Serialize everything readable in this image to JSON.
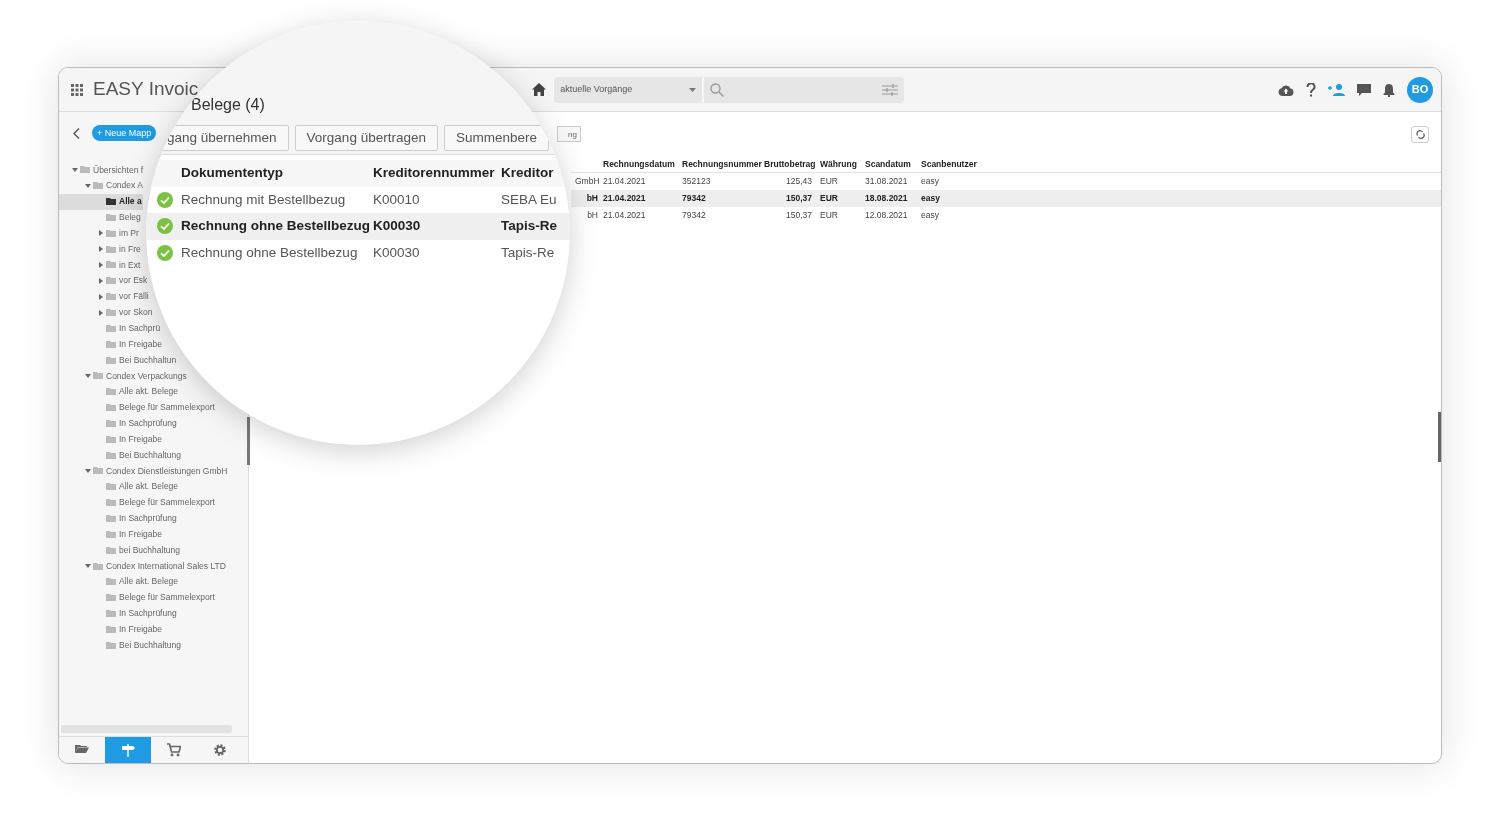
{
  "header": {
    "title": "EASY Invoic",
    "view_select": "aktuelle Vorgänge",
    "avatar": "BO"
  },
  "sidebar": {
    "new_button": "+ Neue Mapp",
    "tree": [
      {
        "label": "Übersichten f",
        "expanded": true,
        "selected": false,
        "children": [
          {
            "label": "Condex A",
            "expanded": true,
            "selected": false,
            "children": [
              {
                "label": "Alle a",
                "selected": true
              },
              {
                "label": "Beleg",
                "selected": false
              },
              {
                "label": "im Pr",
                "expanded": false,
                "selected": false
              },
              {
                "label": "in Fre",
                "expanded": false,
                "selected": false
              },
              {
                "label": "in Ext",
                "expanded": false,
                "selected": false
              },
              {
                "label": "vor Esk",
                "expanded": false,
                "selected": false
              },
              {
                "label": "vor Fälli",
                "expanded": false,
                "selected": false
              },
              {
                "label": "vor Skon",
                "expanded": false,
                "selected": false
              },
              {
                "label": "In Sachprü",
                "selected": false
              },
              {
                "label": "In Freigabe",
                "selected": false
              },
              {
                "label": "Bei Buchhaltun",
                "selected": false
              }
            ]
          },
          {
            "label": "Condex Verpackungs",
            "expanded": true,
            "selected": false,
            "children": [
              {
                "label": "Alle akt. Belege",
                "selected": false
              },
              {
                "label": "Belege für Sammelexport",
                "selected": false
              },
              {
                "label": "In Sachprüfung",
                "selected": false
              },
              {
                "label": "In Freigabe",
                "selected": false
              },
              {
                "label": "Bei Buchhaltung",
                "selected": false
              }
            ]
          },
          {
            "label": "Condex Dienstleistungen GmbH",
            "expanded": true,
            "selected": false,
            "children": [
              {
                "label": "Alle akt. Belege",
                "selected": false
              },
              {
                "label": "Belege für Sammelexport",
                "selected": false
              },
              {
                "label": "In Sachprüfung",
                "selected": false
              },
              {
                "label": "In Freigabe",
                "selected": false
              },
              {
                "label": "bei Buchhaltung",
                "selected": false
              }
            ]
          },
          {
            "label": "Condex International Sales LTD",
            "expanded": true,
            "selected": false,
            "children": [
              {
                "label": "Alle akt. Belege",
                "selected": false
              },
              {
                "label": "Belege für Sammelexport",
                "selected": false
              },
              {
                "label": "In Sachprüfung",
                "selected": false
              },
              {
                "label": "In Freigabe",
                "selected": false
              },
              {
                "label": "Bei Buchhaltung",
                "selected": false
              }
            ]
          }
        ]
      }
    ],
    "bottom_tabs": [
      {
        "kind": "folder",
        "selected": false
      },
      {
        "kind": "signpost",
        "selected": true
      },
      {
        "kind": "cart",
        "selected": false
      },
      {
        "kind": "settings",
        "selected": false
      }
    ]
  },
  "main": {
    "toolbar_button": "ng",
    "table": {
      "columns": [
        "Rechnungsdatum",
        "Rechnungsnummer",
        "Bruttobetrag",
        "Währung",
        "Scandatum",
        "Scanbenutzer"
      ],
      "rows": [
        {
          "column_1": "GmbH",
          "cells": [
            "21.04.2021",
            "352123",
            "125,43",
            "EUR",
            "31.08.2021",
            "easy"
          ],
          "selected": false
        },
        {
          "column_1": "bH",
          "cells": [
            "21.04.2021",
            "79342",
            "150,37",
            "EUR",
            "18.08.2021",
            "easy"
          ],
          "selected": true
        },
        {
          "column_1": "bH",
          "cells": [
            "21.04.2021",
            "79342",
            "150,37",
            "EUR",
            "12.08.2021",
            "easy"
          ],
          "selected": false
        }
      ]
    }
  },
  "magnifier": {
    "title": "Belege (4)",
    "buttons": [
      "gang übernehmen",
      "Vorgang übertragen",
      "Summenbere"
    ],
    "table": {
      "columns": [
        "Dokumententyp",
        "Kreditorennummer",
        "Kreditor"
      ],
      "rows": [
        {
          "cells": [
            "Rechnung mit Bestellbezug",
            "K00010",
            "SEBA Eu"
          ],
          "selected": false
        },
        {
          "cells": [
            "Rechnung ohne Bestellbezug",
            "K00030",
            "Tapis-Re"
          ],
          "selected": true
        },
        {
          "cells": [
            "Rechnung ohne Bestellbezug",
            "K00030",
            "Tapis-Re"
          ],
          "selected": false
        }
      ]
    }
  }
}
